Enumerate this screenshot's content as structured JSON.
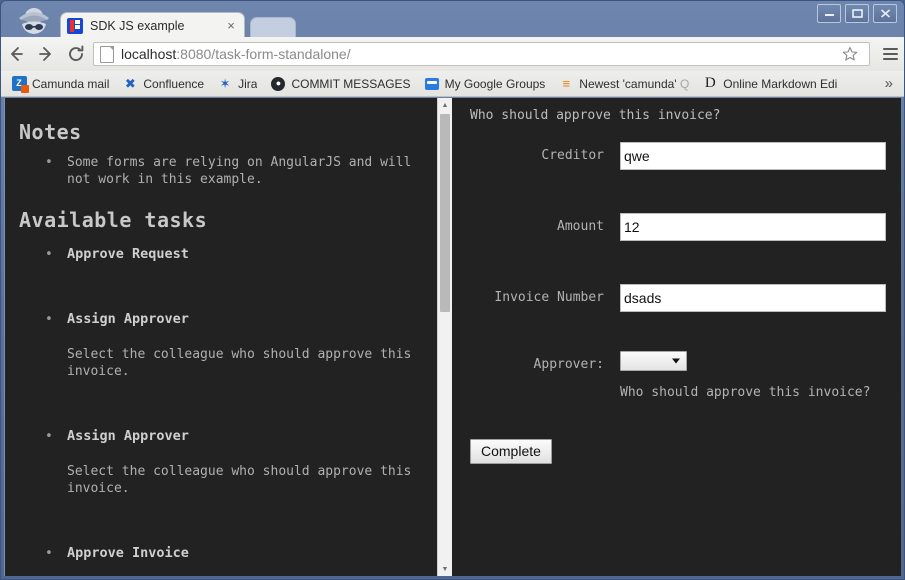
{
  "window": {
    "controls": {
      "minimize": "minimize-button",
      "maximize": "maximize-button",
      "close": "close-button"
    }
  },
  "browser": {
    "tab": {
      "title": "SDK JS example",
      "close_label": "×"
    },
    "toolbar": {
      "back_label": "Back",
      "forward_label": "Forward",
      "reload_label": "Reload",
      "url_host": "localhost",
      "url_rest": ":8080/task-form-standalone/",
      "star_label": "Bookmark this page",
      "menu_label": "Customize and control"
    },
    "bookmarks": {
      "items": [
        {
          "label": "Camunda mail",
          "icon": "camunda-icon",
          "glyph": "Z"
        },
        {
          "label": "Confluence",
          "icon": "confluence-icon",
          "glyph": "✖"
        },
        {
          "label": "Jira",
          "icon": "jira-icon",
          "glyph": "✶"
        },
        {
          "label": "COMMIT MESSAGES",
          "icon": "github-icon",
          "glyph": "●"
        },
        {
          "label": "My Google Groups",
          "icon": "google-groups-icon",
          "glyph": ""
        },
        {
          "label": "Newest 'camunda' ",
          "label_dim": "Q",
          "icon": "stackoverflow-icon",
          "glyph": "≡"
        },
        {
          "label": "Online Markdown Edi",
          "icon": "dillinger-icon",
          "glyph": "D"
        }
      ],
      "overflow_label": "»"
    }
  },
  "notes_pane": {
    "heading_notes": "Notes",
    "notes": [
      "Some forms are relying on AngularJS and will\nnot work in this example."
    ],
    "heading_tasks": "Available tasks",
    "tasks": [
      {
        "title": "Approve Request",
        "description": ""
      },
      {
        "title": "Assign Approver",
        "description": "Select the colleague who should approve this\ninvoice."
      },
      {
        "title": "Assign Approver",
        "description": "Select the colleague who should approve this\ninvoice."
      },
      {
        "title": "Approve Invoice",
        "description": ""
      }
    ],
    "scrollbar": {
      "up_arrow": "▲",
      "down_arrow": "▼"
    }
  },
  "form_pane": {
    "question": "Who should approve this invoice?",
    "fields": [
      {
        "label": "Creditor",
        "value": "qwe",
        "placeholder": ""
      },
      {
        "label": "Amount",
        "value": "12",
        "placeholder": ""
      },
      {
        "label": "Invoice Number",
        "value": "dsads",
        "placeholder": ""
      }
    ],
    "approver": {
      "label": "Approver:",
      "selected": "",
      "options": [],
      "help_text": "Who should approve this invoice?"
    },
    "submit_label": "Complete"
  },
  "colors": {
    "page_background": "#222222",
    "titlebar": "#5a7099",
    "text_muted": "#b0b0b0",
    "input_background": "#ffffff"
  }
}
